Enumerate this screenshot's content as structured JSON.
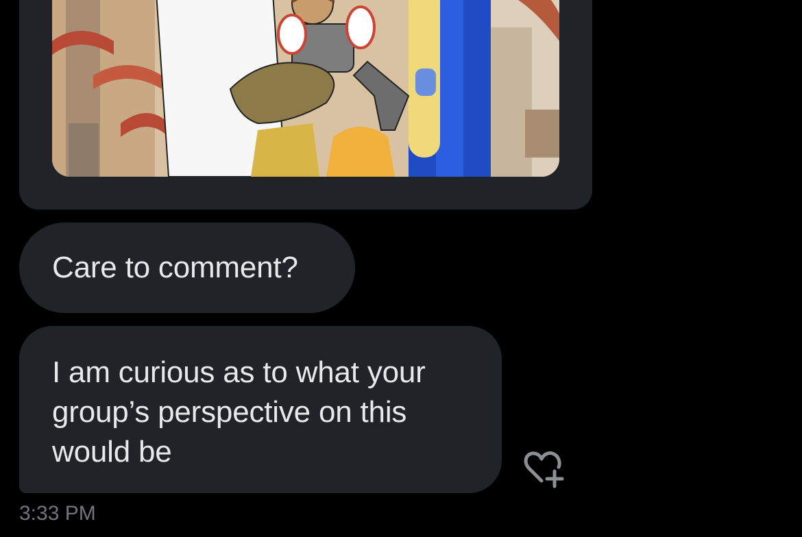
{
  "conversation": {
    "image_message": {
      "image_icon": "illustration-image"
    },
    "messages": [
      {
        "text": "Care to comment?"
      },
      {
        "text": "I am curious as to what your group’s perspective on this would be"
      }
    ],
    "timestamp": "3:33 PM",
    "react_icon": "heart-plus-icon"
  },
  "colors": {
    "background": "#000000",
    "bubble": "#202327",
    "text": "#e7e9ea",
    "muted": "#71767b"
  }
}
